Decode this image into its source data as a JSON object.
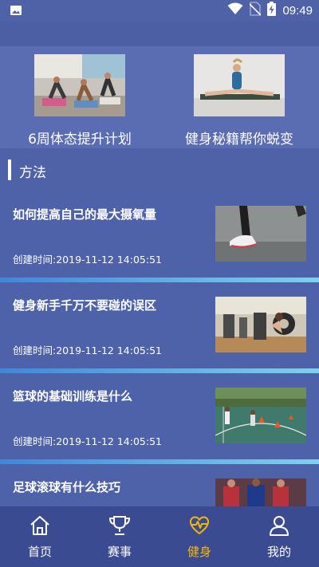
{
  "status_bar": {
    "time": "09:49"
  },
  "banner": {
    "items": [
      {
        "label": "6周体态提升计划"
      },
      {
        "label": "健身秘籍帮你蜕变"
      }
    ]
  },
  "section": {
    "title": "方法"
  },
  "articles": [
    {
      "title": "如何提高自己的最大摄氧量",
      "created": "创建时间:2019-11-12 14:05:51"
    },
    {
      "title": "健身新手千万不要碰的误区",
      "created": "创建时间:2019-11-12 14:05:51"
    },
    {
      "title": "篮球的基础训练是什么",
      "created": "创建时间:2019-11-12 14:05:51"
    },
    {
      "title": "足球滚球有什么技巧",
      "created": ""
    }
  ],
  "tabbar": {
    "tabs": [
      {
        "label": "首页"
      },
      {
        "label": "赛事"
      },
      {
        "label": "健身"
      },
      {
        "label": "我的"
      }
    ],
    "active_tab": "健身",
    "active_color": "#f2b705"
  }
}
